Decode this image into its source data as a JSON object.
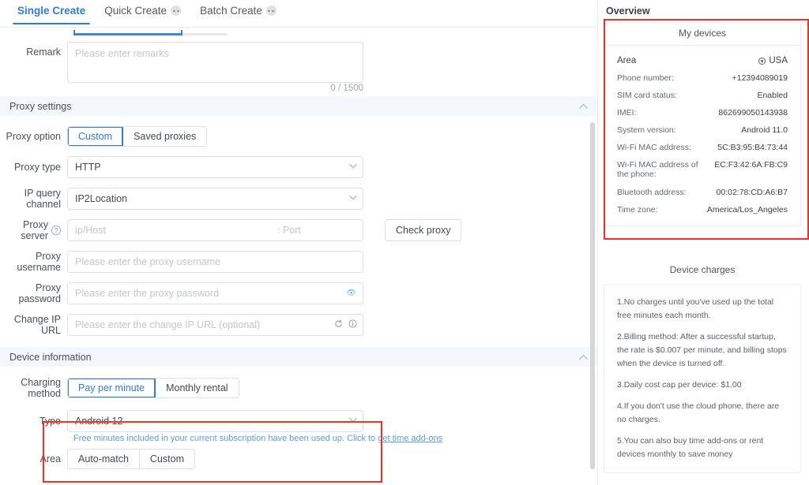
{
  "tabs": [
    {
      "label": "Single Create",
      "active": true,
      "badge": false
    },
    {
      "label": "Quick Create",
      "active": false,
      "badge": true
    },
    {
      "label": "Batch Create",
      "active": false,
      "badge": true
    }
  ],
  "form": {
    "remark": {
      "label": "Remark",
      "placeholder": "Please enter remarks",
      "counter": "0 / 1500"
    }
  },
  "proxy_section": {
    "title": "Proxy settings",
    "option": {
      "label": "Proxy option",
      "options": [
        "Custom",
        "Saved proxies"
      ],
      "selected": "Custom"
    },
    "type": {
      "label": "Proxy type",
      "value": "HTTP"
    },
    "ip_channel": {
      "label": "IP query channel",
      "value": "IP2Location"
    },
    "server": {
      "label": "Proxy server",
      "host_placeholder": "ip/Host",
      "port_placeholder": ": Port",
      "check_button": "Check proxy"
    },
    "username": {
      "label": "Proxy username",
      "placeholder": "Please enter the proxy username"
    },
    "password": {
      "label": "Proxy password",
      "placeholder": "Please enter the proxy password"
    },
    "change_ip_url": {
      "label": "Change IP URL",
      "placeholder": "Please enter the change IP URL (optional)"
    }
  },
  "device_section": {
    "title": "Device information",
    "charging": {
      "label": "Charging method",
      "options": [
        "Pay per minute",
        "Monthly rental"
      ],
      "selected": "Pay per minute"
    },
    "type": {
      "label": "Type",
      "value": "Android 12"
    },
    "notice": {
      "text": "Free minutes included in your current subscription have been used up. Click to ",
      "link": "get time add-ons"
    },
    "area": {
      "label": "Area",
      "options": [
        "Auto-match",
        "Custom"
      ],
      "selected": ""
    }
  },
  "overview": {
    "title": "Overview",
    "my_devices": {
      "title": "My devices",
      "rows": [
        {
          "key": "Area",
          "value": "USA",
          "icon": "location-pin-icon"
        },
        {
          "key": "Phone number:",
          "value": "+12394089019"
        },
        {
          "key": "SIM card status:",
          "value": "Enabled"
        },
        {
          "key": "IMEI:",
          "value": "862699050143938"
        },
        {
          "key": "System version:",
          "value": "Android 11.0"
        },
        {
          "key": "Wi-Fi MAC address:",
          "value": "5C:B3:95:B4:73:44"
        },
        {
          "key": "Wi-Fi MAC address of the phone:",
          "value": "EC:F3:42:6A:FB:C9"
        },
        {
          "key": "Bluetooth address:",
          "value": "00:02:78:CD:A6:B7"
        },
        {
          "key": "Time zone:",
          "value": "America/Los_Angeles"
        }
      ]
    },
    "device_charges": {
      "title": "Device charges",
      "items": [
        "1.No charges until you've used up the total free minutes each month.",
        "2.Billing method: After a successful startup, the rate is $0.007 per minute, and billing stops when the device is turned off.",
        "3.Daily cost cap per device: $1.00",
        "4.If you don't use the cloud phone, there are no charges.",
        "5.You can also buy time add-ons or rent devices monthly to save money"
      ]
    }
  },
  "colors": {
    "accent": "#2f7ae5",
    "annotation": "#fb2c21",
    "section_bg": "#f4f7fc"
  }
}
